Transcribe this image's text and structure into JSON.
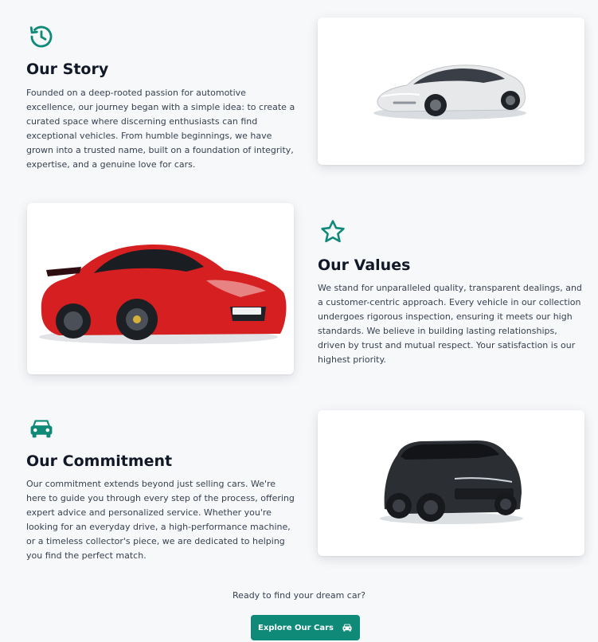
{
  "accent_color": "#0f8a78",
  "sections": [
    {
      "icon": "history-icon",
      "title": "Our Story",
      "text": "Founded on a deep-rooted passion for automotive excellence, our journey began with a simple idea: to create a curated space where discerning enthusiasts can find exceptional vehicles. From humble beginnings, we have grown into a trusted name, built on a foundation of integrity, expertise, and a genuine love for cars.",
      "image": "silver-sedan-image"
    },
    {
      "icon": "star-icon",
      "title": "Our Values",
      "text": "We stand for unparalleled quality, transparent dealings, and a customer-centric approach. Every vehicle in our collection undergoes rigorous inspection, ensuring it meets our high standards. We believe in building lasting relationships, driven by trust and mutual respect. Your satisfaction is our highest priority.",
      "image": "red-sports-car-image"
    },
    {
      "icon": "car-icon",
      "title": "Our Commitment",
      "text": "Our commitment extends beyond just selling cars. We're here to guide you through every step of the process, offering expert advice and personalized service. Whether you're looking for an everyday drive, a high-performance machine, or a timeless collector's piece, we are dedicated to helping you find the perfect match.",
      "image": "black-suv-image"
    }
  ],
  "cta": {
    "prompt": "Ready to find your dream car?",
    "button_label": "Explore Our Cars",
    "button_icon": "car-icon"
  }
}
